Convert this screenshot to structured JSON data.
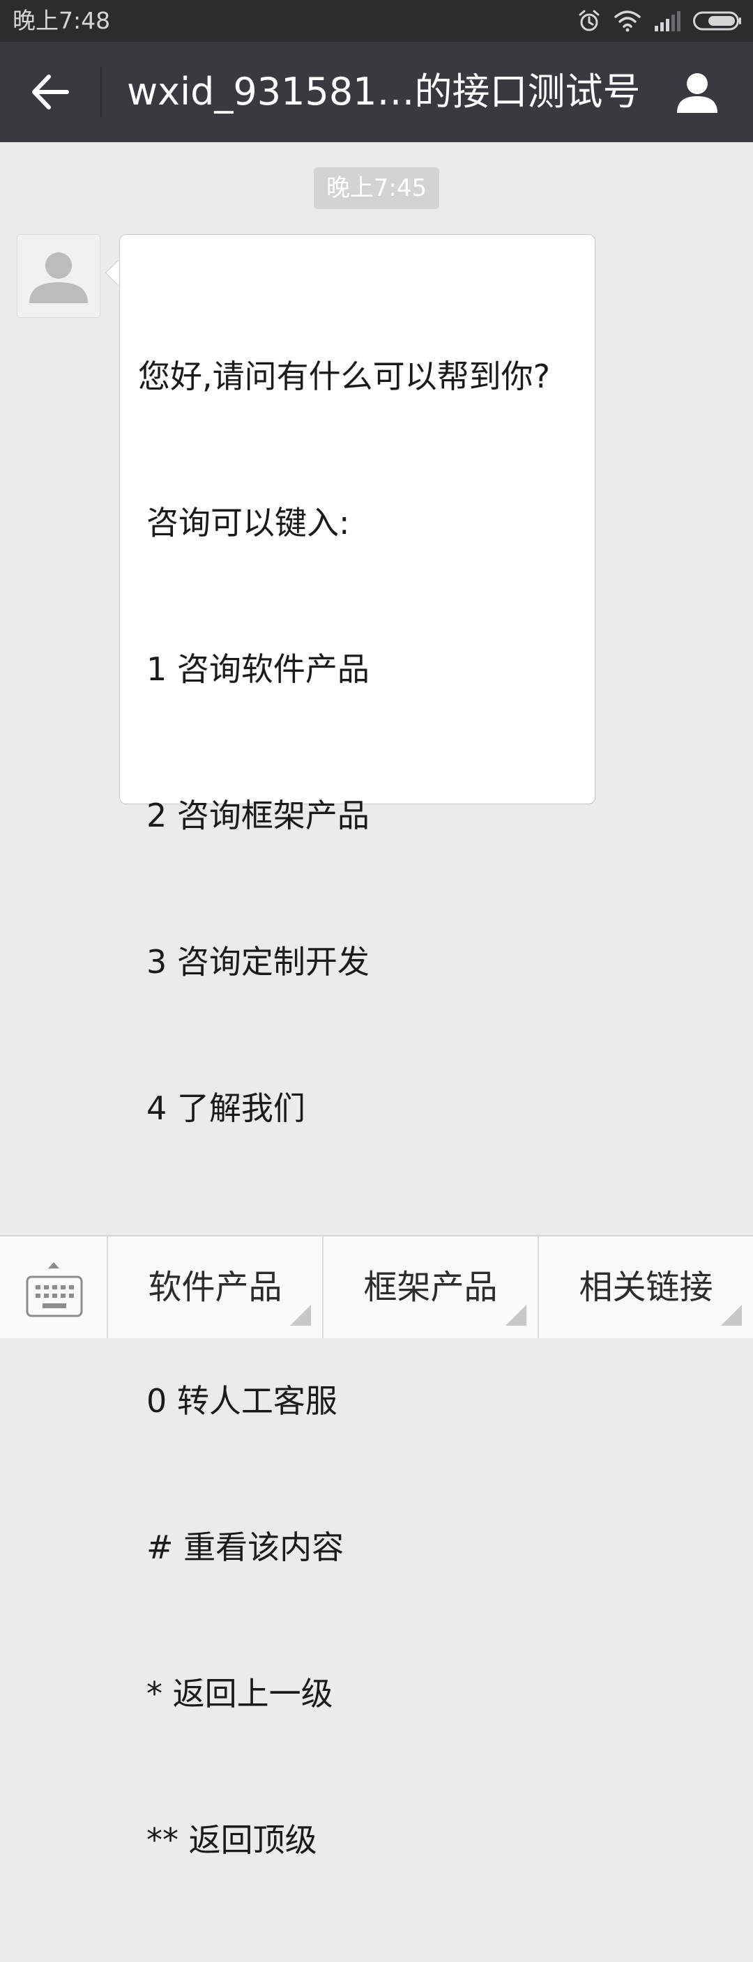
{
  "status_bar": {
    "time": "晚上7:48",
    "icons": [
      "alarm-icon",
      "wifi-icon",
      "signal-icon",
      "battery-icon"
    ]
  },
  "header": {
    "title": "wxid_931581…的接口测试号",
    "back_icon": "back-arrow-icon",
    "profile_icon": "person-icon"
  },
  "chat": {
    "timestamp": "晚上7:45",
    "message": {
      "lines": [
        "您好,请问有什么可以帮到你?",
        "咨询可以键入:",
        "1 咨询软件产品",
        "2 咨询框架产品",
        "3 咨询定制开发",
        "4 了解我们",
        "",
        "0 转人工客服",
        "# 重看该内容",
        "* 返回上一级",
        "** 返回顶级"
      ]
    }
  },
  "bottom_menu": {
    "keyboard_icon": "keyboard-icon",
    "items": [
      {
        "label": "软件产品"
      },
      {
        "label": "框架产品"
      },
      {
        "label": "相关链接"
      }
    ]
  },
  "colors": {
    "status_bar_bg": "#2b2c30",
    "title_bar_bg": "#393a3f",
    "chat_bg": "#ebebeb",
    "bubble_bg": "#ffffff",
    "bottom_bar_bg": "#fafafa"
  }
}
